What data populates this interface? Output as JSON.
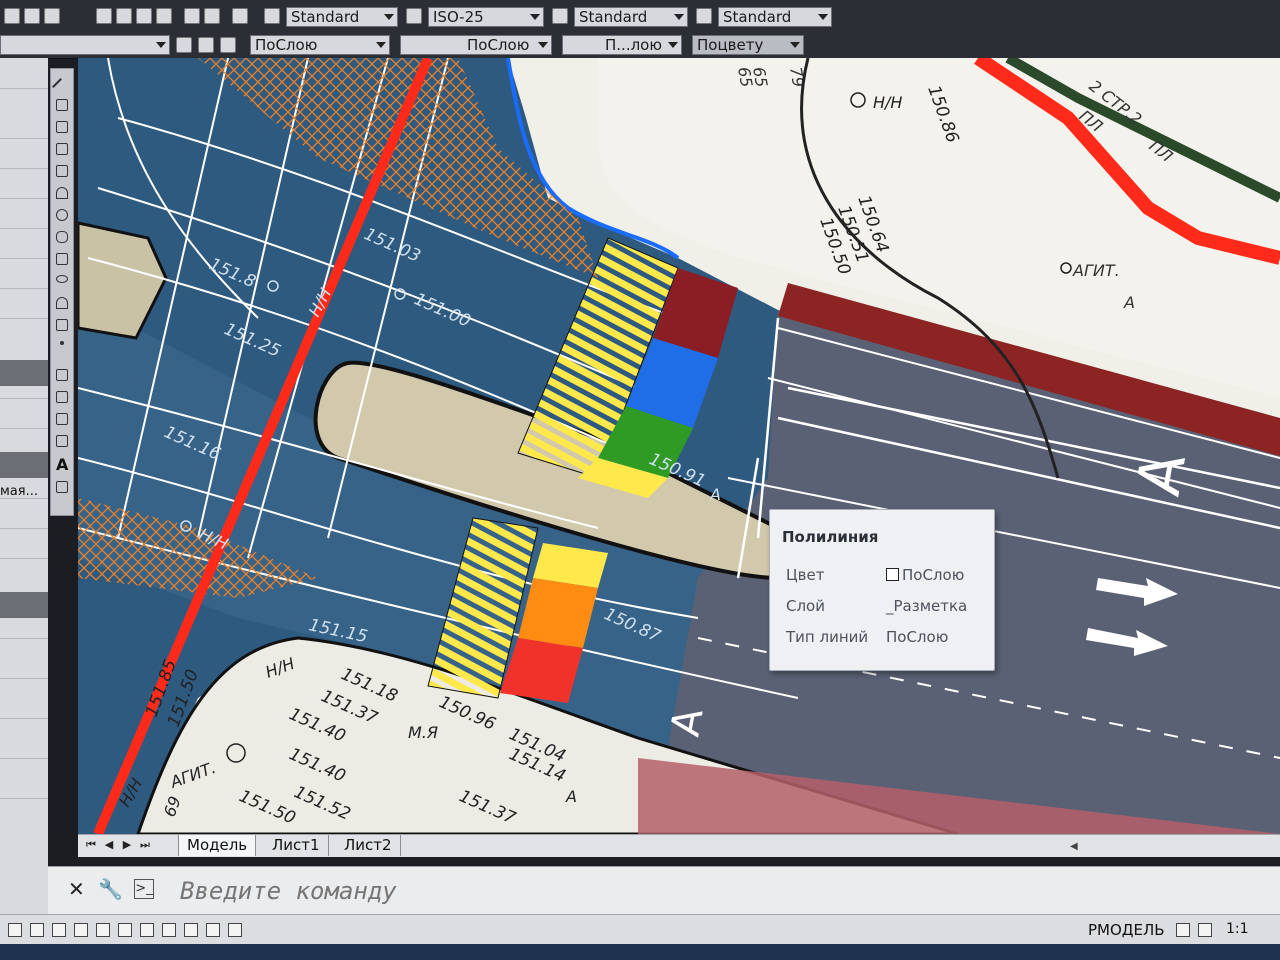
{
  "toolbar": {
    "text_style": "Standard",
    "dim_style": "ISO-25",
    "table_style": "Standard",
    "multileader_style": "Standard",
    "layer_color": "ПоСлою",
    "linetype": "ПоСлою",
    "lineweight": "П...лою",
    "plot_style": "Поцвету"
  },
  "left_panel": {
    "truncated_label": "мая..."
  },
  "draw_toolbar": {
    "text_tool": "A"
  },
  "drawing": {
    "elevations": [
      "151.03",
      "151.8",
      "151.00",
      "151.25",
      "151.16",
      "150.91",
      "150.87",
      "151.15",
      "151.18",
      "151.37",
      "151.40",
      "151.40",
      "151.52",
      "151.50",
      "150.96",
      "151.04",
      "151.14",
      "151.37",
      "150.86",
      "150.64",
      "150.51",
      "150.50",
      "151.85",
      "151.50"
    ],
    "labels": {
      "nn1": "Н/Н",
      "nn2": "Н/Н",
      "nn3": "Н/Н",
      "nn4": "Н/Н",
      "nn5": "Н/Н",
      "agit1": "АГИТ.",
      "agit2": "АГИТ.",
      "a1": "А",
      "a2": "А",
      "a3": "А",
      "street": "2 СТР.2",
      "mya": "М.Я",
      "pl1": "ПЛ",
      "pl2": "ПЛ",
      "num65a": "65",
      "num65b": "65",
      "num79": "79",
      "num69": "69",
      "road_letter": "А"
    },
    "colors": {
      "road_blue": "#2f5a80",
      "asphalt": "#5a6174",
      "red_line": "#ff2a1a",
      "orange_hatch": "#f58220",
      "crosswalk_yellow": "#ffe94a"
    }
  },
  "tooltip": {
    "title": "Полилиния",
    "color_label": "Цвет",
    "color_value": "ПоСлою",
    "layer_label": "Слой",
    "layer_value": "_Разметка",
    "linetype_label": "Тип линий",
    "linetype_value": "ПоСлою"
  },
  "layout_tabs": [
    "Модель",
    "Лист1",
    "Лист2"
  ],
  "command_line": {
    "placeholder": "Введите команду"
  },
  "status": {
    "model": "РМОДЕЛЬ",
    "scale": "1:1"
  }
}
